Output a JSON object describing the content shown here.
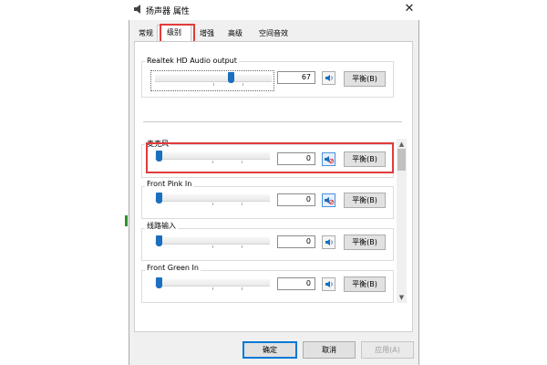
{
  "window": {
    "title": "扬声器 属性",
    "close_glyph": "✕",
    "tabs": [
      "常规",
      "级别",
      "增强",
      "高级",
      "空间音效"
    ],
    "active_tab_index": 1
  },
  "top_device": {
    "name": "Realtek HD Audio output",
    "value": "67",
    "balance_label": "平衡(B)"
  },
  "inputs": [
    {
      "name": "麦克风",
      "value": "0",
      "balance_label": "平衡(B)",
      "muted": true,
      "highlighted": true
    },
    {
      "name": "Front Pink In",
      "value": "0",
      "balance_label": "平衡(B)",
      "muted": true
    },
    {
      "name": "线路输入",
      "value": "0",
      "balance_label": "平衡(B)",
      "muted": false
    },
    {
      "name": "Front Green In",
      "value": "0",
      "balance_label": "平衡(B)",
      "muted": false
    }
  ],
  "buttons": {
    "ok": "确定",
    "cancel": "取消",
    "apply": "应用(A)"
  },
  "colors": {
    "accent": "#1a6fbf",
    "highlight": "#e23b3b"
  },
  "icons": {
    "speaker": "speaker-icon",
    "muted": "speaker-muted-icon",
    "scroll_up": "▲",
    "scroll_down": "▼"
  }
}
